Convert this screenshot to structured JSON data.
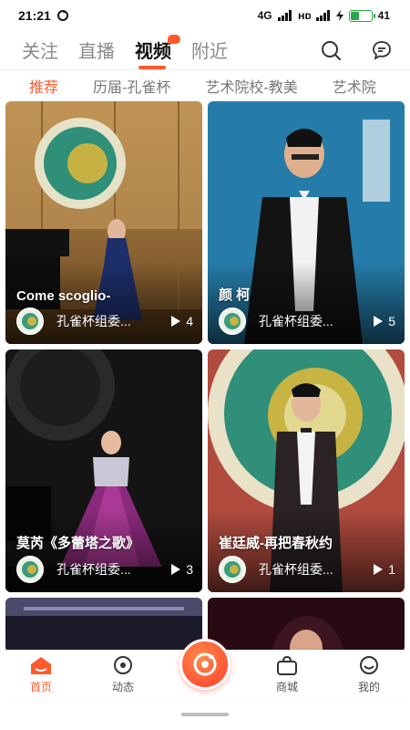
{
  "status_bar": {
    "time": "21:21",
    "network": "4G",
    "battery": "41",
    "battery_level": 0.41
  },
  "top_tabs": [
    {
      "label": "关注"
    },
    {
      "label": "直播"
    },
    {
      "label": "视频"
    },
    {
      "label": "附近"
    }
  ],
  "sub_tabs": [
    {
      "label": "推荐"
    },
    {
      "label": "历届-孔雀杯"
    },
    {
      "label": "艺术院校-教美"
    },
    {
      "label": "艺术院"
    }
  ],
  "cards": [
    {
      "title": "Come scoglio-",
      "author": "孔雀杯组委...",
      "plays": "4"
    },
    {
      "title": "颜 柯",
      "author": "孔雀杯组委...",
      "plays": "5"
    },
    {
      "title": "莫芮《多蕾塔之歌》",
      "author": "孔雀杯组委...",
      "plays": "3"
    },
    {
      "title": "崔廷威-再把春秋约",
      "author": "孔雀杯组委...",
      "plays": "1"
    },
    {
      "title": "",
      "author": "",
      "plays": ""
    },
    {
      "title": "",
      "author": "",
      "plays": ""
    }
  ],
  "bottom_nav": [
    {
      "label": "首页"
    },
    {
      "label": "动态"
    },
    {
      "label": "商城"
    },
    {
      "label": "我的"
    }
  ],
  "colors": {
    "accent": "#ff5a2c",
    "battery": "#2aa844"
  }
}
